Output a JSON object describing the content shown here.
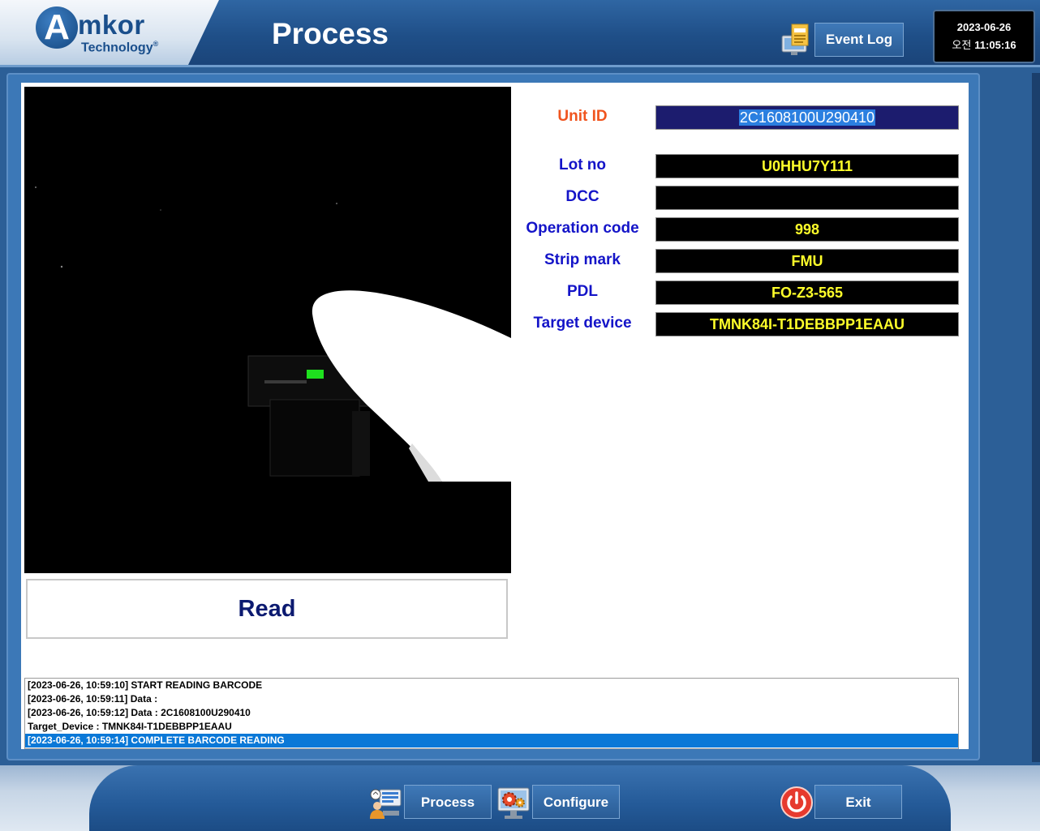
{
  "header": {
    "logo_letter": "A",
    "logo_word": "mkor",
    "logo_sub": "Technology",
    "logo_reg": "®",
    "title": "Process",
    "event_log_label": "Event Log",
    "event_log_icon": "event-log-icon",
    "clock": {
      "date": "2023-06-26",
      "ampm": "오전",
      "time": "11:05:16"
    }
  },
  "main": {
    "read_button": "Read",
    "fields": [
      {
        "label": "Unit ID",
        "value": "2C1608100U290410"
      },
      {
        "label": "Lot no",
        "value": "U0HHU7Y111"
      },
      {
        "label": "DCC",
        "value": ""
      },
      {
        "label": "Operation code",
        "value": "998"
      },
      {
        "label": "Strip mark",
        "value": "FMU"
      },
      {
        "label": "PDL",
        "value": "FO-Z3-565"
      },
      {
        "label": "Target device",
        "value": "TMNK84I-T1DEBBPP1EAAU"
      }
    ],
    "log": [
      "[2023-06-26, 10:59:10] START READING BARCODE",
      "[2023-06-26, 10:59:11] Data :",
      "[2023-06-26, 10:59:12] Data : 2C1608100U290410",
      "Target_Device : TMNK84I-T1DEBBPP1EAAU",
      "[2023-06-26, 10:59:14] COMPLETE BARCODE READING"
    ]
  },
  "footer": {
    "process_label": "Process",
    "configure_label": "Configure",
    "exit_label": "Exit"
  },
  "colors": {
    "label_blue": "#1414c8",
    "label_accent": "#f0541e",
    "value_yellow": "#ffff2a",
    "header_blue": "#1f4f88"
  }
}
